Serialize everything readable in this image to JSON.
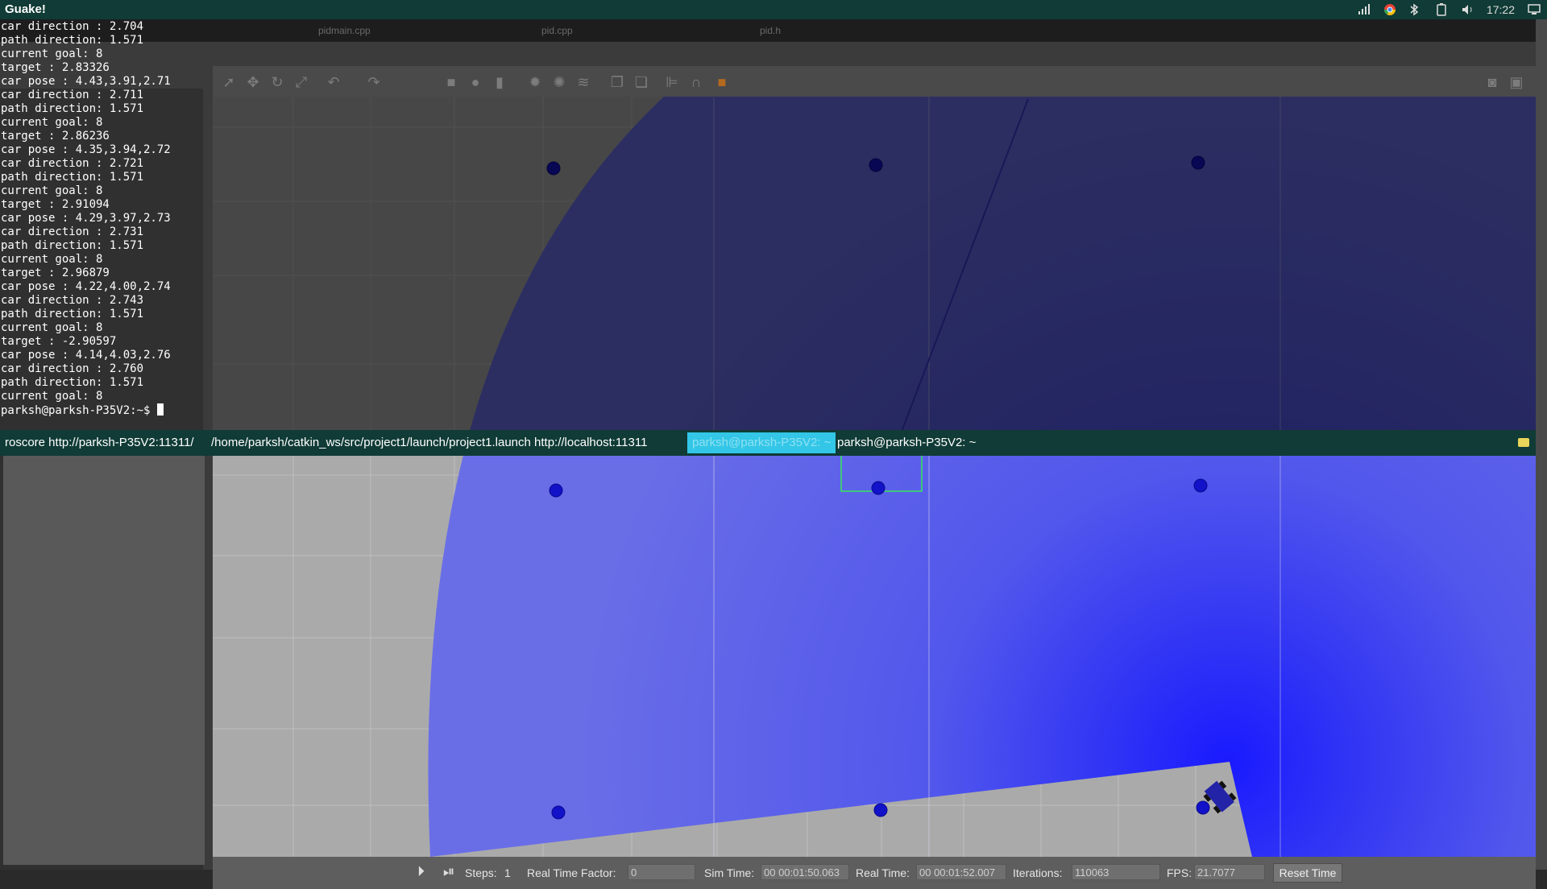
{
  "topbar": {
    "app_title": "Guake!",
    "clock": "17:22"
  },
  "tray_icons": [
    "signal-icon",
    "chrome-icon",
    "bluetooth-icon",
    "battery-icon",
    "volume-icon",
    "monitor-icon"
  ],
  "editor_tabs": [
    "pidmain.cpp",
    "pid.cpp",
    "pid.h"
  ],
  "terminal": {
    "lines": [
      "car direction : 2.704",
      "path direction: 1.571",
      "current goal: 8",
      "target : 2.83326",
      "car pose : 4.43,3.91,2.71",
      "car direction : 2.711",
      "path direction: 1.571",
      "current goal: 8",
      "target : 2.86236",
      "car pose : 4.35,3.94,2.72",
      "car direction : 2.721",
      "path direction: 1.571",
      "current goal: 8",
      "target : 2.91094",
      "car pose : 4.29,3.97,2.73",
      "car direction : 2.731",
      "path direction: 1.571",
      "current goal: 8",
      "target : 2.96879",
      "car pose : 4.22,4.00,2.74",
      "car direction : 2.743",
      "path direction: 1.571",
      "current goal: 8",
      "target : -2.90597",
      "car pose : 4.14,4.03,2.76",
      "car direction : 2.760",
      "path direction: 1.571",
      "current goal: 8"
    ],
    "prompt": "parksh@parksh-P35V2:~$ "
  },
  "guake_tabs": [
    "roscore http://parksh-P35V2:11311/",
    "/home/parksh/catkin_ws/src/project1/launch/project1.launch http://localhost:11311",
    "parksh@parksh-P35V2: ~",
    "parksh@parksh-P35V2: ~"
  ],
  "toolbar_icons": [
    "select-arrow-icon",
    "translate-icon",
    "rotate-icon",
    "scale-icon",
    "undo-icon",
    "redo-icon",
    "box-icon",
    "sphere-icon",
    "cylinder-icon",
    "sun-light-icon",
    "point-light-icon",
    "spot-light-icon",
    "copy-icon",
    "paste-icon",
    "align-icon",
    "snap-icon",
    "orange-shape-icon",
    "screenshot-icon",
    "record-icon"
  ],
  "statusbar": {
    "steps_label": "Steps:",
    "steps_value": "1",
    "rtf_label": "Real Time Factor:",
    "rtf_value": "0",
    "sim_label": "Sim Time:",
    "sim_value": "00 00:01:50.063",
    "real_label": "Real Time:",
    "real_value": "00 00:01:52.007",
    "iter_label": "Iterations:",
    "iter_value": "110063",
    "fps_label": "FPS:",
    "fps_value": "21.7077",
    "reset_label": "Reset Time"
  },
  "colors": {
    "guake_bar": "#103b36",
    "active_tab": "#33c6e7",
    "laser_blue": "#4b4ff0",
    "marker": "#1212c8"
  }
}
